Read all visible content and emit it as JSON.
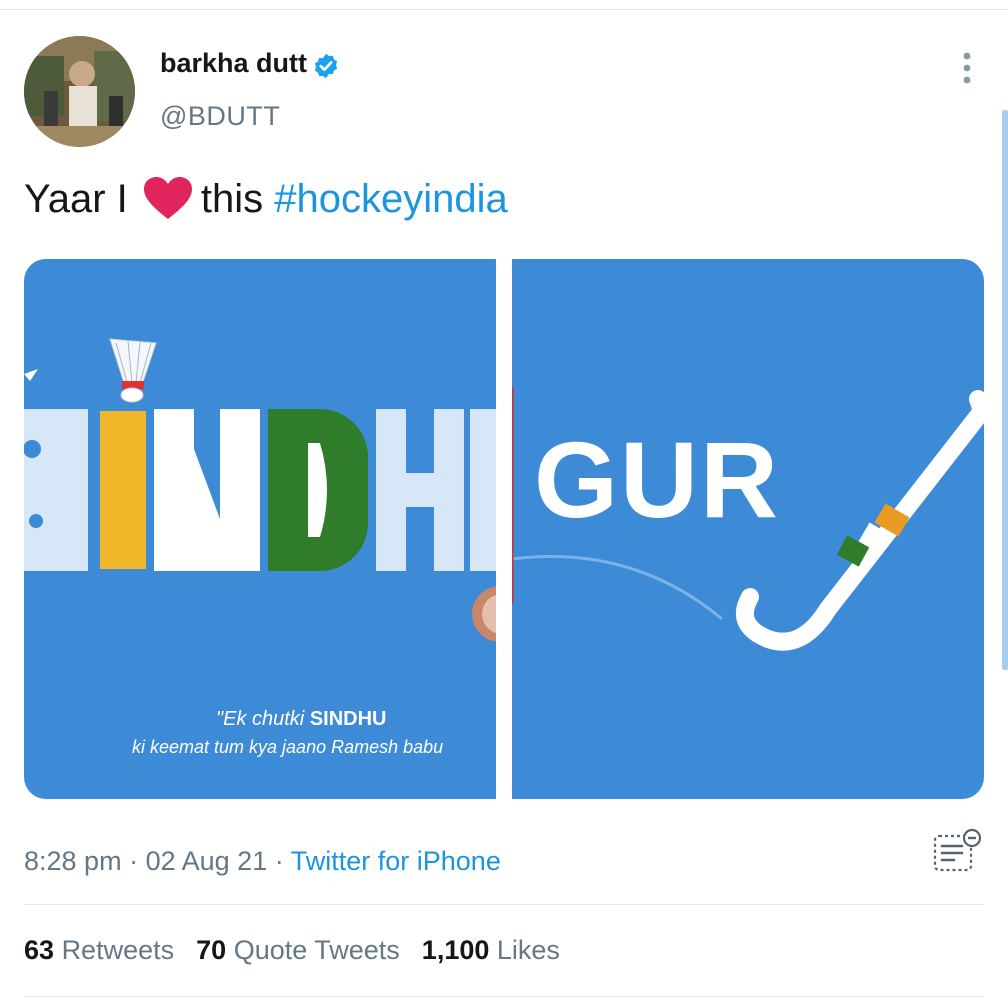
{
  "tweet": {
    "author": {
      "name": "barkha dutt",
      "handle": "@BDUTT",
      "verified": true,
      "avatar_icon": "profile-photo"
    },
    "text": {
      "before": "Yaar I",
      "emoji": "red-heart-icon",
      "middle": "this",
      "hashtag": "#hockeyindia"
    },
    "media": {
      "left_image": {
        "title_letters": [
          "S",
          "I",
          "N",
          "D",
          "H",
          "U"
        ],
        "quote_line1_prefix": "\"Ek chutki",
        "quote_line1_bold": "SINDHU",
        "quote_line2": "ki keemat tum kya jaano Ramesh babu"
      },
      "right_image": {
        "title": "GUR"
      }
    },
    "meta": {
      "time": "8:28 pm",
      "separator": "·",
      "date": "02 Aug 21",
      "source": "Twitter for iPhone"
    },
    "stats": {
      "retweets_count": "63",
      "retweets_label": "Retweets",
      "quotes_count": "70",
      "quotes_label": "Quote Tweets",
      "likes_count": "1,100",
      "likes_label": "Likes"
    }
  },
  "colors": {
    "link": "#1b95e0",
    "secondary_text": "#657786",
    "media_bg": "#3d8ad6",
    "heart": "#e0245e"
  }
}
